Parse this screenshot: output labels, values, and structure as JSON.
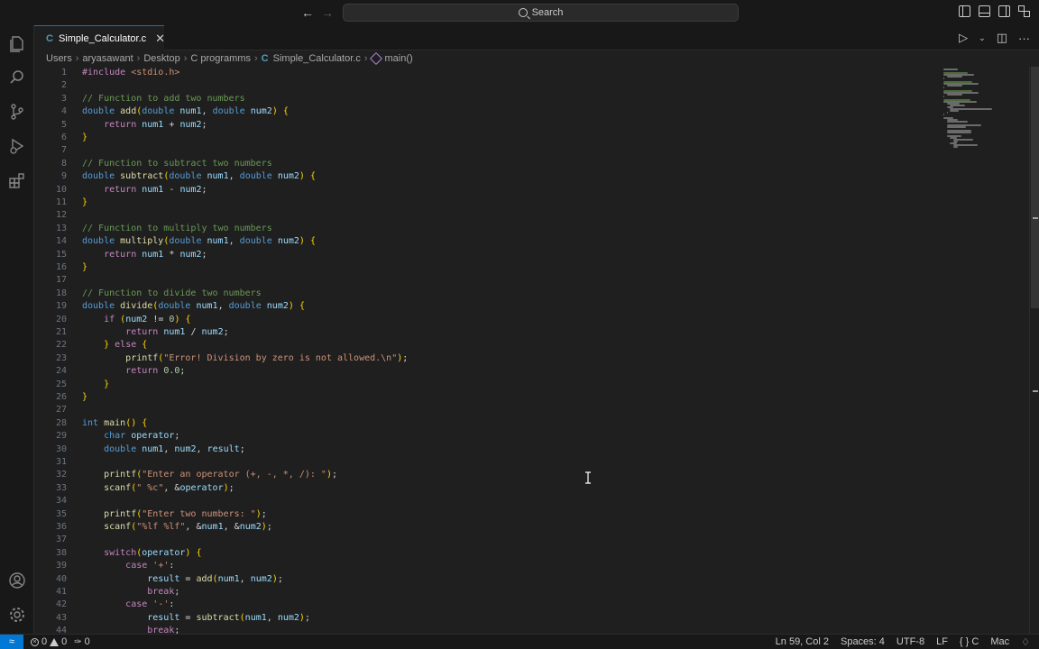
{
  "titlebar": {
    "search_label": "Search",
    "back_icon": "arrow-left-icon",
    "forward_icon": "arrow-right-icon"
  },
  "tab": {
    "file_type": "C",
    "label": "Simple_Calculator.c"
  },
  "breadcrumb": {
    "items": [
      "Users",
      "aryasawant",
      "Desktop",
      "C programms"
    ],
    "file_type": "C",
    "file": "Simple_Calculator.c",
    "symbol": "main()"
  },
  "editor": {
    "line_numbers": [
      "1",
      "2",
      "3",
      "4",
      "5",
      "6",
      "7",
      "8",
      "9",
      "10",
      "11",
      "12",
      "13",
      "14",
      "15",
      "16",
      "17",
      "18",
      "19",
      "20",
      "21",
      "22",
      "23",
      "24",
      "25",
      "26",
      "27",
      "28",
      "29",
      "30",
      "31",
      "32",
      "33",
      "34",
      "35",
      "36",
      "37",
      "38",
      "39",
      "40",
      "41",
      "42",
      "43",
      "44"
    ],
    "lines": [
      "#include <stdio.h>",
      "",
      "// Function to add two numbers",
      "double add(double num1, double num2) {",
      "    return num1 + num2;",
      "}",
      "",
      "// Function to subtract two numbers",
      "double subtract(double num1, double num2) {",
      "    return num1 - num2;",
      "}",
      "",
      "// Function to multiply two numbers",
      "double multiply(double num1, double num2) {",
      "    return num1 * num2;",
      "}",
      "",
      "// Function to divide two numbers",
      "double divide(double num1, double num2) {",
      "    if (num2 != 0) {",
      "        return num1 / num2;",
      "    } else {",
      "        printf(\"Error! Division by zero is not allowed.\\n\");",
      "        return 0.0;",
      "    }",
      "}",
      "",
      "int main() {",
      "    char operator;",
      "    double num1, num2, result;",
      "",
      "    printf(\"Enter an operator (+, -, *, /): \");",
      "    scanf(\" %c\", &operator);",
      "",
      "    printf(\"Enter two numbers: \");",
      "    scanf(\"%lf %lf\", &num1, &num2);",
      "",
      "    switch(operator) {",
      "        case '+':",
      "            result = add(num1, num2);",
      "            break;",
      "        case '-':",
      "            result = subtract(num1, num2);",
      "            break;"
    ]
  },
  "statusbar": {
    "errors": "0",
    "warnings": "0",
    "ports": "0",
    "position": "Ln 59, Col 2",
    "spaces": "Spaces: 4",
    "encoding": "UTF-8",
    "eol": "LF",
    "language": "C",
    "platform": "Mac"
  },
  "colors": {
    "accent": "#0078d4",
    "keyword": "#569cd6",
    "function": "#dcdcaa",
    "string": "#ce9178",
    "comment": "#6a9955"
  }
}
